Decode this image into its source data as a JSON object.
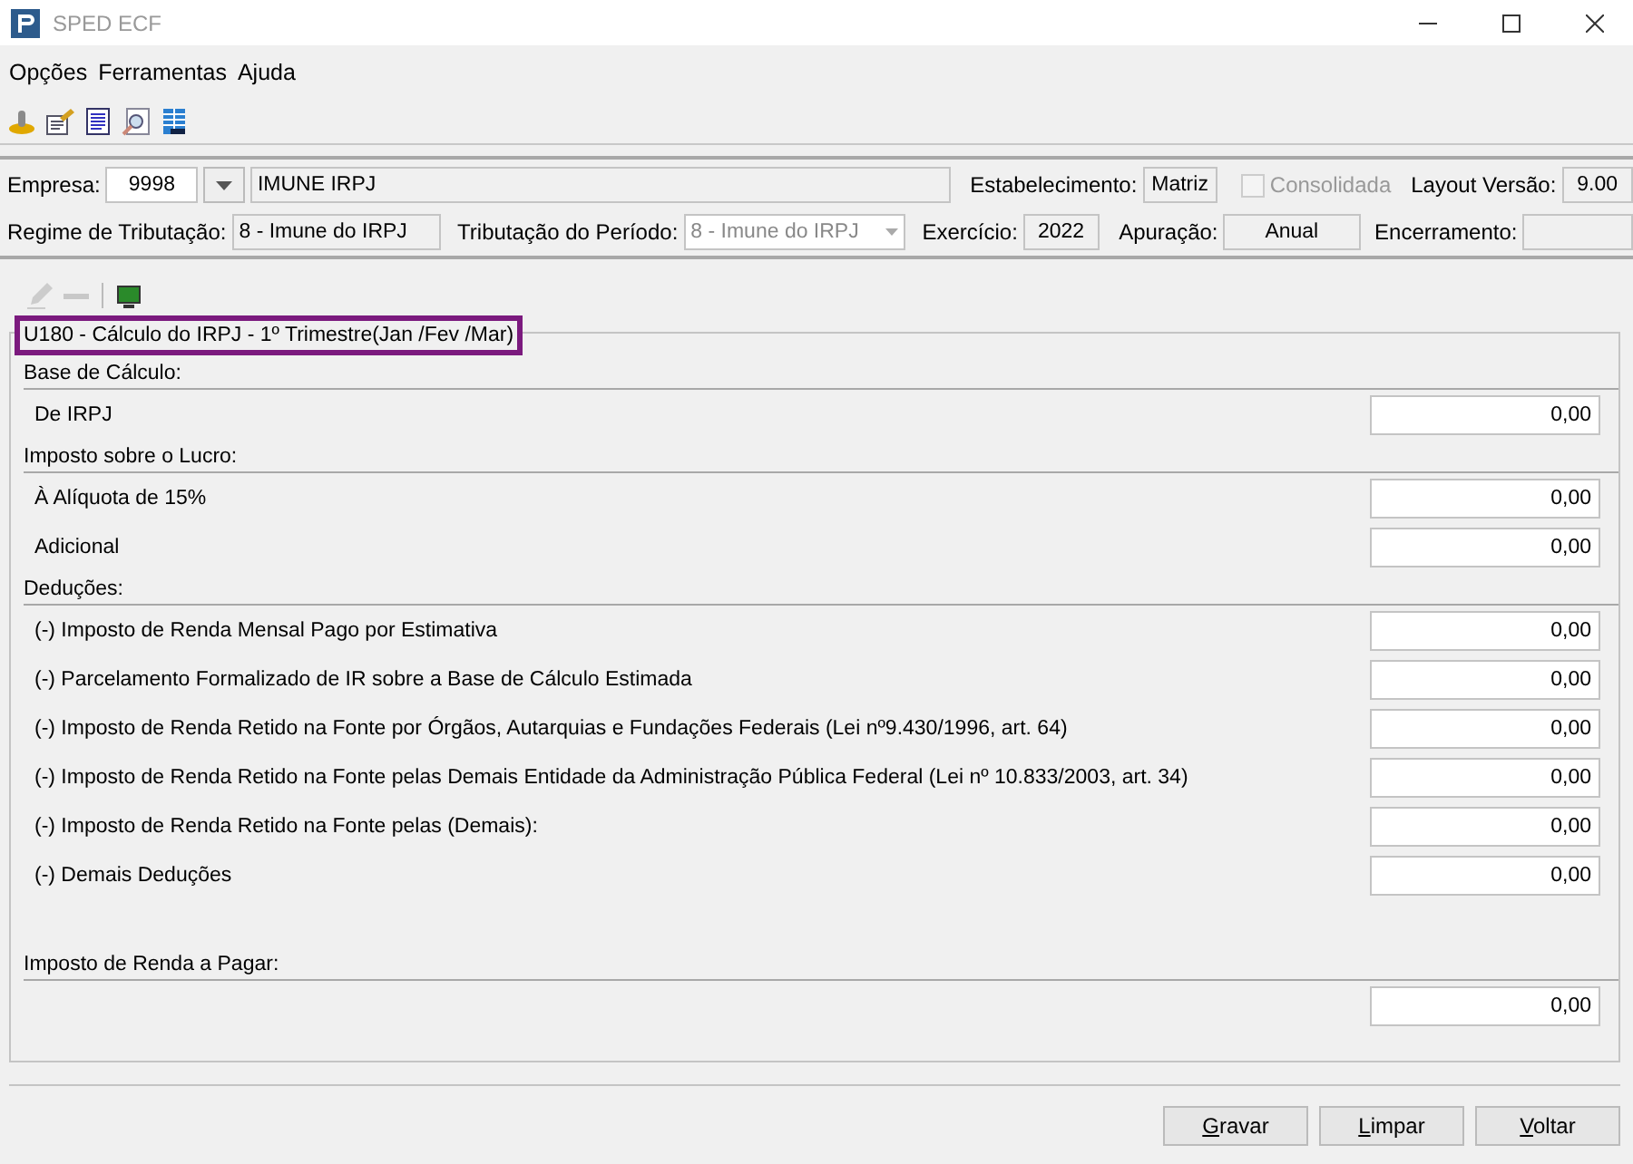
{
  "window": {
    "title": "SPED ECF"
  },
  "menu": [
    "Opções",
    "Ferramentas",
    "Ajuda"
  ],
  "header": {
    "empresa": {
      "label": "Empresa:",
      "code": "9998",
      "name": "IMUNE IRPJ"
    },
    "estabelecimento": {
      "label": "Estabelecimento:",
      "value": "Matriz"
    },
    "consolidada": {
      "label": "Consolidada",
      "checked": false,
      "disabled": true
    },
    "layout": {
      "label": "Layout Versão:",
      "value": "9.00"
    },
    "regime": {
      "label": "Regime de Tributação:",
      "value": "8 - Imune do IRPJ"
    },
    "tributacao": {
      "label": "Tributação do Período:",
      "value": "8 - Imune do IRPJ",
      "disabled": true
    },
    "exercicio": {
      "label": "Exercício:",
      "value": "2022"
    },
    "apuracao": {
      "label": "Apuração:",
      "value": "Anual"
    },
    "encerramento": {
      "label": "Encerramento:"
    }
  },
  "form": {
    "title": "U180 - Cálculo do IRPJ - 1º Trimestre(Jan /Fev /Mar)",
    "highlighted": true,
    "sections": [
      {
        "heading": "Base de Cálculo:",
        "rows": [
          {
            "label": "De IRPJ",
            "value": "0,00"
          }
        ]
      },
      {
        "heading": "Imposto sobre o Lucro:",
        "rows": [
          {
            "label": "À Alíquota de 15%",
            "value": "0,00"
          },
          {
            "label": "Adicional",
            "value": "0,00"
          }
        ]
      },
      {
        "heading": "Deduções:",
        "rows": [
          {
            "label": "(-) Imposto de Renda Mensal Pago por Estimativa",
            "value": "0,00"
          },
          {
            "label": "(-) Parcelamento Formalizado de IR sobre a Base de Cálculo Estimada",
            "value": "0,00"
          },
          {
            "label": "(-) Imposto de Renda Retido na Fonte por Órgãos, Autarquias e Fundações Federais (Lei nº9.430/1996, art. 64)",
            "value": "0,00"
          },
          {
            "label": "(-) Imposto de Renda Retido na Fonte pelas Demais Entidade da Administração Pública Federal (Lei nº 10.833/2003, art. 34)",
            "value": "0,00"
          },
          {
            "label": "(-) Imposto de Renda Retido na Fonte pelas (Demais):",
            "value": "0,00"
          },
          {
            "label": "(-) Demais Deduções",
            "value": "0,00"
          }
        ]
      },
      {
        "heading": "Imposto de Renda a Pagar:",
        "rows": [
          {
            "value": "0,00"
          }
        ]
      }
    ]
  },
  "buttons": [
    "Gravar",
    "Limpar",
    "Voltar"
  ]
}
